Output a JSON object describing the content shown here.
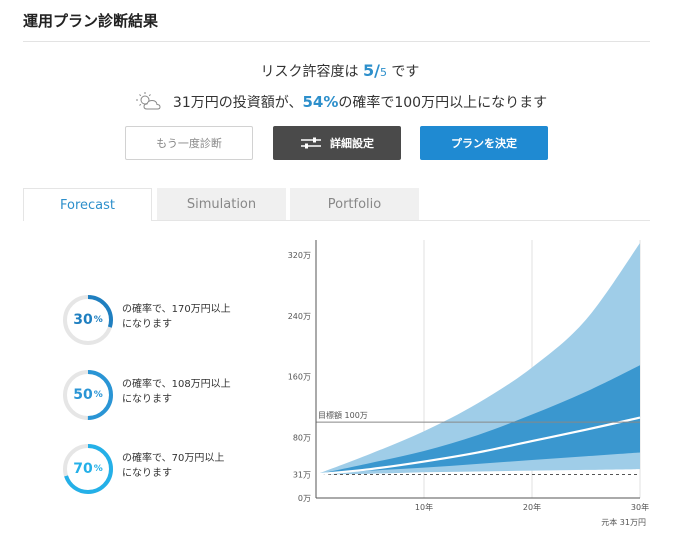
{
  "header": {
    "title": "運用プラン診断結果"
  },
  "summary": {
    "risk_prefix": "リスク許容度は ",
    "risk_value": "5",
    "risk_slash": "/",
    "risk_max": "5",
    "risk_suffix": " です",
    "forecast_prefix": "31万円の投資額が、",
    "forecast_pct": "54%",
    "forecast_suffix": "の確率で100万円以上になります",
    "weather_icon": "partly-cloudy-icon"
  },
  "buttons": {
    "retry": "もう一度診断",
    "detail": "詳細設定",
    "decide": "プランを決定"
  },
  "tabs": [
    {
      "label": "Forecast",
      "active": true
    },
    {
      "label": "Simulation",
      "active": false
    },
    {
      "label": "Portfolio",
      "active": false
    }
  ],
  "probabilities": [
    {
      "pct": "30",
      "unit": "%",
      "line1": "の確率で、170万円以上",
      "line2": "になります",
      "fraction": 0.3,
      "color": "#1f7fc0"
    },
    {
      "pct": "50",
      "unit": "%",
      "line1": "の確率で、108万円以上",
      "line2": "になります",
      "fraction": 0.5,
      "color": "#2a95d5"
    },
    {
      "pct": "70",
      "unit": "%",
      "line1": "の確率で、70万円以上",
      "line2": "になります",
      "fraction": 0.7,
      "color": "#24b0e8"
    }
  ],
  "chart_data": {
    "type": "area",
    "x": [
      0,
      5,
      10,
      15,
      20,
      25,
      30
    ],
    "x_ticks": [
      {
        "value": 10,
        "label": "10年"
      },
      {
        "value": 20,
        "label": "20年"
      },
      {
        "value": 30,
        "label": "30年"
      }
    ],
    "y_ticks": [
      {
        "value": 0,
        "label": "0万"
      },
      {
        "value": 31,
        "label": "31万"
      },
      {
        "value": 80,
        "label": "80万"
      },
      {
        "value": 160,
        "label": "160万"
      },
      {
        "value": 240,
        "label": "240万"
      },
      {
        "value": 320,
        "label": "320万"
      }
    ],
    "ylim": [
      0,
      340
    ],
    "xlim": [
      0,
      30
    ],
    "series": [
      {
        "role": "outer_upper",
        "values": [
          31,
          58,
          88,
          125,
          172,
          235,
          336
        ]
      },
      {
        "role": "outer_lower",
        "values": [
          31,
          32,
          34,
          35,
          36,
          37,
          38
        ]
      },
      {
        "role": "inner_upper",
        "values": [
          31,
          46,
          62,
          83,
          110,
          140,
          175
        ]
      },
      {
        "role": "inner_lower",
        "values": [
          31,
          36,
          40,
          45,
          50,
          55,
          60
        ]
      },
      {
        "role": "median",
        "values": [
          31,
          38,
          48,
          60,
          75,
          90,
          106
        ]
      }
    ],
    "principal": 31,
    "goal": 100,
    "goal_label": "目標額 100万",
    "principal_label": "元本 31万円",
    "colors": {
      "outer": "#9fcde8",
      "inner": "#3a97cf",
      "median": "#ffffff",
      "goal": "#888888"
    }
  }
}
